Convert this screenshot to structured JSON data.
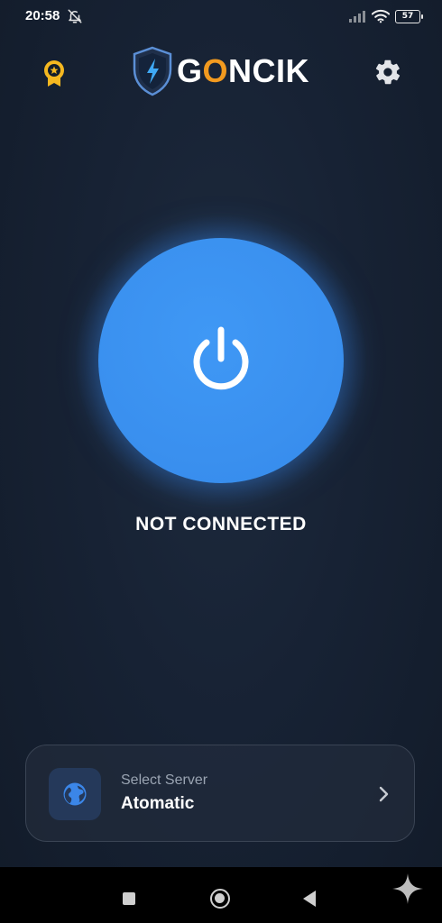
{
  "status_bar": {
    "time": "20:58",
    "battery": "57",
    "icons": [
      "bell-off-icon",
      "signal-icon",
      "wifi-icon",
      "battery-icon"
    ]
  },
  "header": {
    "brand_prefix": "G",
    "brand_o": "O",
    "brand_suffix": "NCIK",
    "brand_accent_color": "#f29a1f",
    "premium_icon": "award-badge-icon",
    "settings_icon": "gear-icon"
  },
  "main": {
    "power_icon": "power-icon",
    "power_color": "#3a90ef",
    "status_text": "NOT CONNECTED"
  },
  "server": {
    "caption": "Select Server",
    "name": "Atomatic",
    "icon": "globe-icon",
    "chevron": "chevron-right-icon"
  },
  "nav": {
    "items": [
      "recent-apps",
      "home",
      "back",
      "assistant"
    ]
  }
}
